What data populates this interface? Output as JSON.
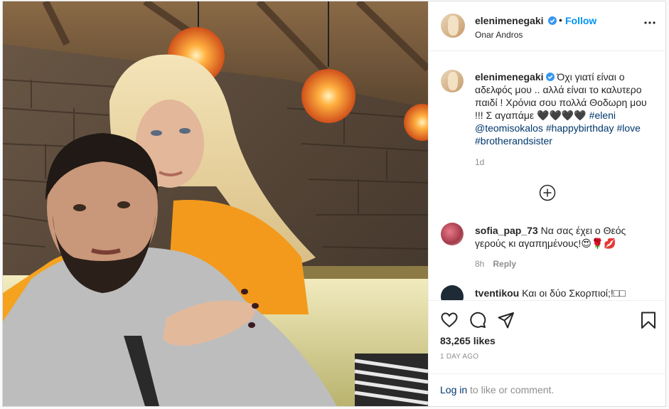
{
  "post": {
    "username": "elenimenegaki",
    "location": "Onar Andros",
    "follow_label": "Follow",
    "dot": "•"
  },
  "caption": {
    "username": "elenimenegaki",
    "text": "Όχι γιατί είναι ο αδελφός μου .. αλλά είναι το καλυτερο παιδί ! Χρόνια σου πολλά Θοδωρη μου !!! Σ αγαπάμε 🖤🖤🖤🖤",
    "tag_eleni": "#eleni",
    "mention": "@teomisokalos",
    "tag_happy": "#happybirthday",
    "tag_love": "#love",
    "tag_bros": "#brotherandsister",
    "time": "1d"
  },
  "comments": [
    {
      "username": "sofia_pap_73",
      "text": "Να σας έχει ο Θεός γερούς κι αγαπημένους!😍🌹💋",
      "time": "8h",
      "reply_label": "Reply"
    },
    {
      "username": "tventikou",
      "text": "Και οι δύο Σκορπιοί;!□□"
    }
  ],
  "stats": {
    "likes": "83,265 likes",
    "posted": "1 DAY AGO"
  },
  "login": {
    "link": "Log in",
    "rest": " to like or comment."
  },
  "colors": {
    "accent": "#0095f6",
    "link": "#00376b",
    "muted": "#8e8e8e",
    "border": "#dbdbdb"
  },
  "icons": [
    "verified-badge-icon",
    "more-options-icon",
    "load-more-comments-icon",
    "heart-icon",
    "comment-icon",
    "share-icon",
    "bookmark-icon"
  ]
}
